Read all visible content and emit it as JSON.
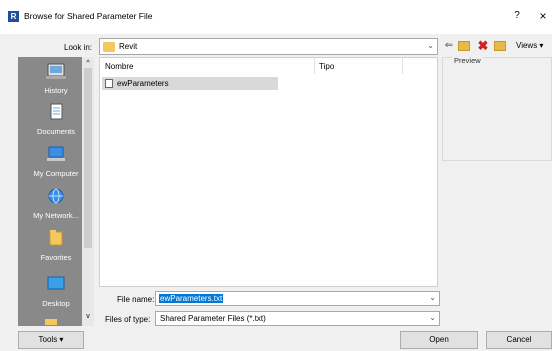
{
  "window": {
    "title": "Browse for Shared Parameter File",
    "app_icon_letter": "R",
    "help": "?",
    "close": "×"
  },
  "lookin": {
    "label": "Look in:",
    "value": "Revit"
  },
  "toolbar": {
    "views_label": "Views ▾"
  },
  "places": [
    {
      "label": "History",
      "icon": "history-icon"
    },
    {
      "label": "Documents",
      "icon": "documents-icon"
    },
    {
      "label": "My Computer",
      "icon": "computer-icon"
    },
    {
      "label": "My Network...",
      "icon": "network-icon"
    },
    {
      "label": "Favorites",
      "icon": "favorites-icon"
    },
    {
      "label": "Desktop",
      "icon": "desktop-icon"
    }
  ],
  "filelist": {
    "columns": [
      "Nombre",
      "Tipo"
    ],
    "files": [
      {
        "name": "ewParameters",
        "type": ""
      }
    ]
  },
  "preview": {
    "label": "Preview"
  },
  "filename": {
    "label": "File name:",
    "value": "ewParameters.txt"
  },
  "filetype": {
    "label": "Files of type:",
    "value": "Shared Parameter Files (*.txt)"
  },
  "buttons": {
    "tools": "Tools  ▾",
    "open": "Open",
    "cancel": "Cancel"
  },
  "colors": {
    "places_bg": "#898989",
    "selection": "#0078d7",
    "app_icon": "#1f4e9c"
  }
}
